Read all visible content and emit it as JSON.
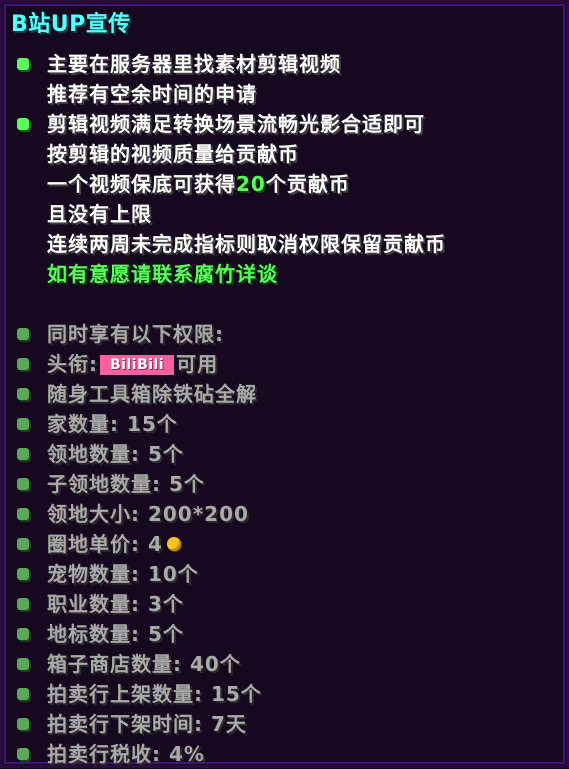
{
  "tooltip": {
    "title": "B站UP宣传",
    "lines": [
      "主要在服务器里找素材剪辑视频",
      "推荐有空余时间的申请",
      "剪辑视频满足转换场景流畅光影合适即可",
      "按剪辑的视频质量给贡献币",
      "一个视频保底可获得",
      "20",
      "个贡献币",
      "且没有上限",
      "连续两周未完成指标则取消权限保留贡献币",
      "如有意愿请联系腐竹详谈"
    ],
    "perks": {
      "header": "同时享有以下权限:",
      "title_prefix": "头衔:",
      "title_badge": "BiliBili",
      "title_suffix": "可用",
      "items": [
        "随身工具箱除铁砧全解",
        "家数量: 15个",
        "领地数量: 5个",
        "子领地数量: 5个",
        "领地大小: 200*200",
        "圈地单价: 4",
        "宠物数量: 10个",
        "职业数量: 3个",
        "地标数量: 5个",
        "箱子商店数量: 40个",
        "拍卖行上架数量: 15个",
        "拍卖行下架时间: 7天",
        "拍卖行税收: 4%"
      ]
    },
    "icons": {
      "bullet": "green-square-bullet-icon",
      "coin": "gold-coin-icon"
    },
    "colors": {
      "title": "#55ffff",
      "text": "#ffffff",
      "highlight": "#55ff55",
      "muted": "#aaaaaa",
      "badge": "#ff5fa0",
      "coin": "#ffc21a"
    }
  }
}
